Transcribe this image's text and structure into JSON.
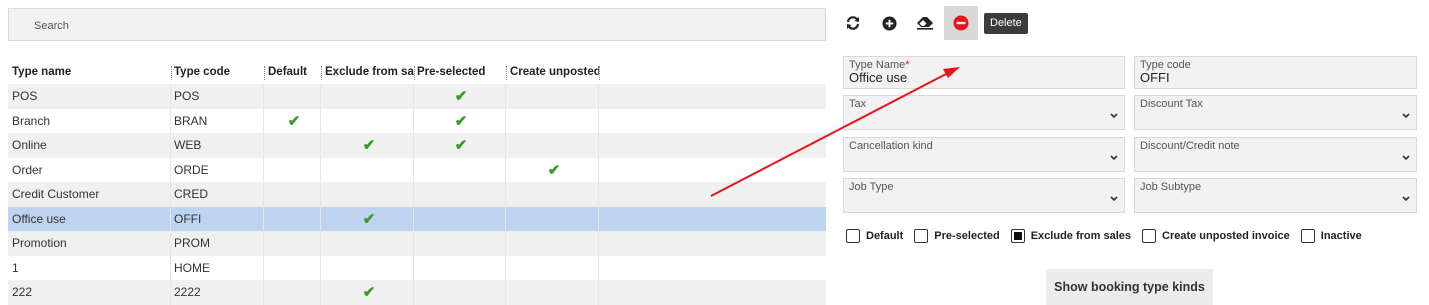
{
  "search": {
    "placeholder": "Search"
  },
  "grid": {
    "columns": [
      "Type name",
      "Type code",
      "Default",
      "Exclude from sale",
      "Pre-selected",
      "Create unposted i"
    ],
    "rows": [
      {
        "name": "POS",
        "code": "POS",
        "default": false,
        "exclude": false,
        "preselected": true,
        "unposted": false
      },
      {
        "name": "Branch",
        "code": "BRAN",
        "default": true,
        "exclude": false,
        "preselected": true,
        "unposted": false
      },
      {
        "name": "Online",
        "code": "WEB",
        "default": false,
        "exclude": true,
        "preselected": true,
        "unposted": false
      },
      {
        "name": "Order",
        "code": "ORDE",
        "default": false,
        "exclude": false,
        "preselected": false,
        "unposted": true
      },
      {
        "name": "Credit Customer",
        "code": "CRED",
        "default": false,
        "exclude": false,
        "preselected": false,
        "unposted": false
      },
      {
        "name": "Office use",
        "code": "OFFI",
        "default": false,
        "exclude": true,
        "preselected": false,
        "unposted": false,
        "selected": true
      },
      {
        "name": "Promotion",
        "code": "PROM",
        "default": false,
        "exclude": false,
        "preselected": false,
        "unposted": false
      },
      {
        "name": "1",
        "code": "HOME",
        "default": false,
        "exclude": false,
        "preselected": false,
        "unposted": false
      },
      {
        "name": "222",
        "code": "2222",
        "default": false,
        "exclude": true,
        "preselected": false,
        "unposted": false
      }
    ]
  },
  "toolbar": {
    "icons": [
      "refresh-icon",
      "add-icon",
      "eraser-icon",
      "remove-icon"
    ],
    "delete_label": "Delete"
  },
  "form": {
    "type_name_label": "Type Name",
    "required_mark": "*",
    "type_name_value": "Office use",
    "type_code_label": "Type code",
    "type_code_value": "OFFI",
    "tax_label": "Tax",
    "discount_tax_label": "Discount Tax",
    "cancellation_kind_label": "Cancellation kind",
    "discount_credit_note_label": "Discount/Credit note",
    "job_type_label": "Job Type",
    "job_subtype_label": "Job Subtype"
  },
  "checkboxes": [
    {
      "label": "Default",
      "checked": false
    },
    {
      "label": "Pre-selected",
      "checked": false
    },
    {
      "label": "Exclude from sales",
      "checked": true
    },
    {
      "label": "Create unposted invoice",
      "checked": false
    },
    {
      "label": "Inactive",
      "checked": false
    }
  ],
  "show_button_label": "Show booking type kinds",
  "colors": {
    "check_green": "#3a9a22",
    "selected_row": "#bdd3ef",
    "annotation_arrow": "#e8141b",
    "remove_red": "#e8141b"
  }
}
